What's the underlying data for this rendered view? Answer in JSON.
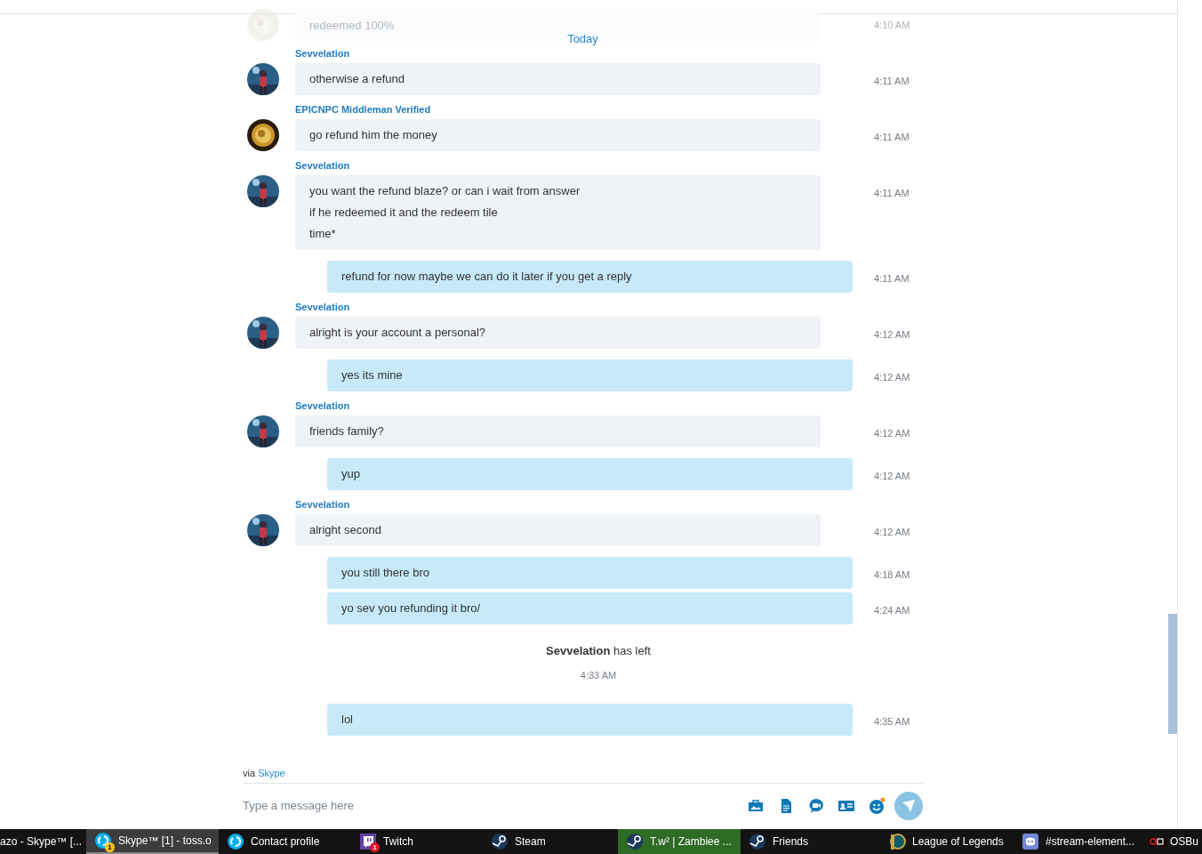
{
  "faded_message": {
    "text": "redeemed 100%",
    "time": "4:10 AM"
  },
  "day_separator": "Today",
  "messages": [
    {
      "kind": "incoming",
      "sender": "Sevvelation",
      "text": "otherwise a refund",
      "time": "4:11 AM"
    },
    {
      "kind": "incoming",
      "sender": "EPICNPC Middleman Verified",
      "text": "go refund him the money",
      "time": "4:11 AM"
    },
    {
      "kind": "incoming",
      "sender": "Sevvelation",
      "text": "you want the refund blaze? or can i wait from answer\nif he redeemed it and the redeem tile\ntime*",
      "time": "4:11 AM"
    },
    {
      "kind": "outgoing",
      "text": "refund for now maybe we can do it later if you get a reply",
      "time": "4:11 AM"
    },
    {
      "kind": "incoming",
      "sender": "Sevvelation",
      "text": "alright is your account a personal?",
      "time": "4:12 AM"
    },
    {
      "kind": "outgoing",
      "text": "yes its mine",
      "time": "4:12 AM"
    },
    {
      "kind": "incoming",
      "sender": "Sevvelation",
      "text": "friends family?",
      "time": "4:12 AM"
    },
    {
      "kind": "outgoing",
      "text": "yup",
      "time": "4:12 AM"
    },
    {
      "kind": "incoming",
      "sender": "Sevvelation",
      "text": "alright second",
      "time": "4:12 AM"
    },
    {
      "kind": "outgoing",
      "text": "you still there bro",
      "time": "4:18 AM"
    },
    {
      "kind": "outgoing",
      "text": "yo sev you refunding it bro/",
      "time": "4:24 AM"
    },
    {
      "kind": "event",
      "text": "**Sevvelation** has left",
      "time": "4:33 AM"
    },
    {
      "kind": "outgoing",
      "text": "lol",
      "time": "4:35 AM"
    }
  ],
  "via": {
    "prefix": "via",
    "link": "Skype"
  },
  "composer": {
    "placeholder": "Type a message here"
  },
  "taskbar": [
    {
      "label": "azo - Skype™ [...",
      "kind": "plain",
      "selected": false,
      "flashing": false
    },
    {
      "label": "Skype™ [1] - toss.o",
      "kind": "skype",
      "badge": "1",
      "selected": true,
      "flashing": false
    },
    {
      "label": "Contact profile",
      "kind": "skype",
      "selected": false,
      "flashing": false
    },
    {
      "label": "Twitch",
      "kind": "twitch",
      "badge": "1",
      "selected": false,
      "flashing": false
    },
    {
      "label": "Steam",
      "kind": "steam",
      "selected": false,
      "flashing": false
    },
    {
      "label": "T.w² | Zambiee ...",
      "kind": "steam",
      "selected": false,
      "flashing": true
    },
    {
      "label": "Friends",
      "kind": "steam",
      "selected": false,
      "flashing": false
    },
    {
      "label": "League of Legends",
      "kind": "league",
      "selected": false,
      "flashing": false
    },
    {
      "label": "#stream-element...",
      "kind": "discord",
      "selected": false,
      "flashing": false
    },
    {
      "label": "OSBu",
      "kind": "osb",
      "selected": false,
      "flashing": false
    }
  ]
}
